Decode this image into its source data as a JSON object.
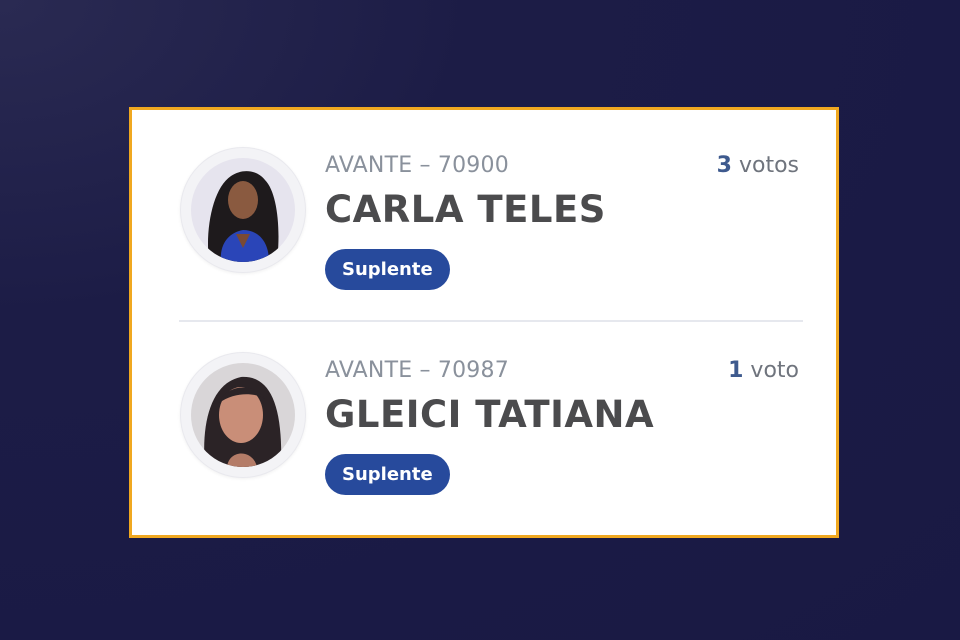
{
  "candidates": [
    {
      "party": "AVANTE – 70900",
      "name": "CARLA TELES",
      "status": "Suplente",
      "votes_count": "3",
      "votes_unit": "votos",
      "avatar_icon": "candidate-photo"
    },
    {
      "party": "AVANTE – 70987",
      "name": "GLEICI TATIANA",
      "status": "Suplente",
      "votes_count": "1",
      "votes_unit": "voto",
      "avatar_icon": "candidate-photo"
    }
  ],
  "colors": {
    "background": "#1c1c46",
    "card_border": "#f0a820",
    "badge": "#274a9c",
    "name": "#4b4b4d"
  }
}
